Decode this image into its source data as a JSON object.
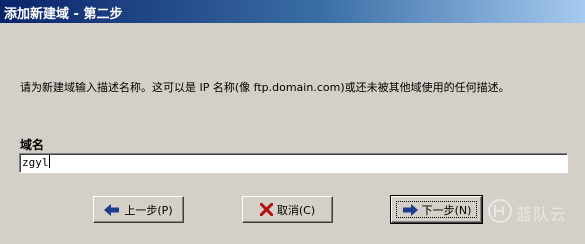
{
  "window": {
    "title": "添加新建域 - 第二步"
  },
  "content": {
    "description": "请为新建域输入描述名称。这可以是 IP 名称(像 ftp.domain.com)或还未被其他域使用的任何描述。",
    "domain_label": "域名",
    "domain_value": "zgyl"
  },
  "buttons": {
    "back_label": "上一步(P)",
    "cancel_label": "取消(C)",
    "next_label": "下一步(N)"
  },
  "watermark": {
    "text": "蓝队云"
  },
  "colors": {
    "titlebar_start": "#0a246a",
    "titlebar_end": "#a6caf0",
    "dialog_bg": "#d4d0c8",
    "arrow_blue": "#1c3d8c",
    "cancel_red": "#b01010"
  }
}
